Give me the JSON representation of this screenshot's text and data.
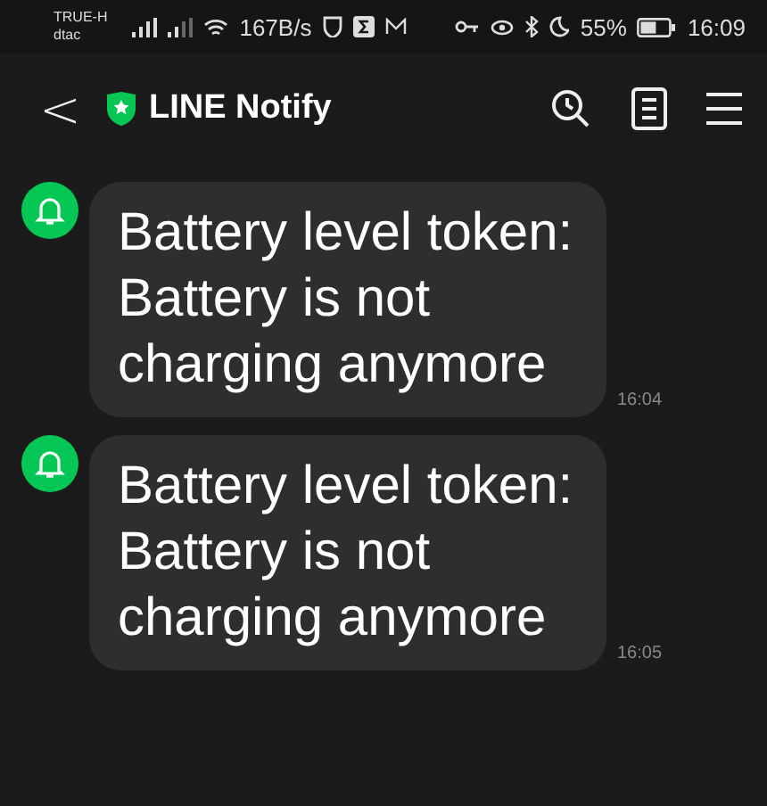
{
  "status_bar": {
    "carrier_1": "TRUE-H",
    "carrier_2": "dtac",
    "speed": "167B/s",
    "battery": "55%",
    "time": "16:09"
  },
  "header": {
    "back": "<",
    "title": "LINE Notify"
  },
  "messages": [
    {
      "text": "Battery level token: Battery is not charging anymore",
      "time": "16:04"
    },
    {
      "text": "Battery level token: Battery is not charging anymore",
      "time": "16:05"
    }
  ]
}
